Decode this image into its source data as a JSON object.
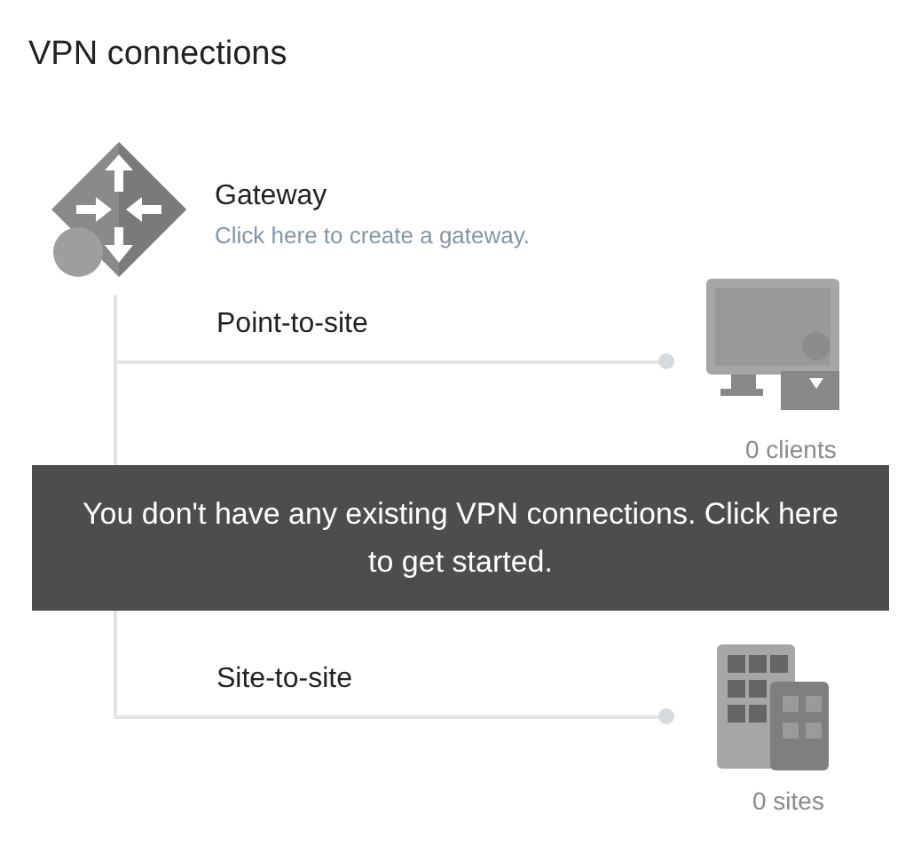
{
  "title": "VPN connections",
  "gateway": {
    "label": "Gateway",
    "link": "Click here to create a gateway."
  },
  "connections": [
    {
      "kind": "point",
      "label": "Point-to-site",
      "count": "0 clients"
    },
    {
      "kind": "site",
      "label": "Site-to-site",
      "count": "0 sites"
    }
  ],
  "overlay": {
    "message": "You don't have any existing VPN connections. Click here to get started."
  }
}
